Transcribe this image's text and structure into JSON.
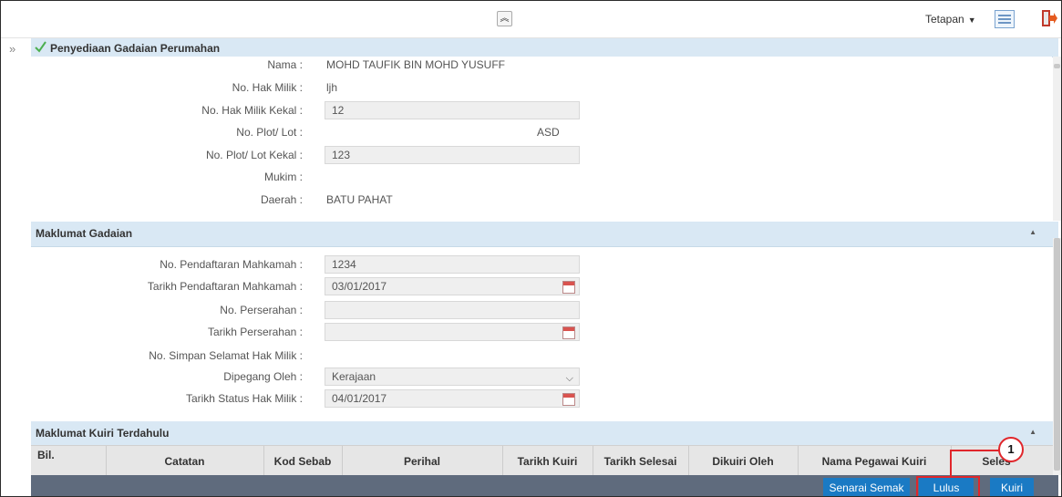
{
  "toolbar": {
    "collapse_glyph": "≈",
    "settings_label": "Tetapan",
    "settings_caret": "▼"
  },
  "side": {
    "expand_glyph": "»"
  },
  "section_prep": {
    "title": "Penyediaan Gadaian Perumahan"
  },
  "property": {
    "nama_label": "Nama :",
    "nama_value": "MOHD TAUFIK BIN MOHD YUSUFF",
    "hakmilik_label": "No. Hak Milik :",
    "hakmilik_value": "ljh",
    "hakmilik_kekal_label": "No. Hak Milik Kekal :",
    "hakmilik_kekal_value": "12",
    "plot_label": "No. Plot/ Lot :",
    "plot_value": "ASD",
    "plot_kekal_label": "No. Plot/ Lot Kekal :",
    "plot_kekal_value": "123",
    "mukim_label": "Mukim :",
    "mukim_value": "",
    "daerah_label": "Daerah :",
    "daerah_value": "BATU PAHAT"
  },
  "section_gadaian": {
    "title": "Maklumat Gadaian",
    "toggle": "▲"
  },
  "gadaian": {
    "pendaftaran_label": "No. Pendaftaran Mahkamah :",
    "pendaftaran_value": "1234",
    "tarikh_pendaftaran_label": "Tarikh Pendaftaran Mahkamah :",
    "tarikh_pendaftaran_value": "03/01/2017",
    "perserahan_label": "No. Perserahan :",
    "perserahan_value": "",
    "tarikh_perserahan_label": "Tarikh Perserahan :",
    "tarikh_perserahan_value": "",
    "simpan_label": "No. Simpan Selamat Hak Milik :",
    "dipegang_label": "Dipegang Oleh :",
    "dipegang_value": "Kerajaan",
    "tarikh_status_label": "Tarikh Status Hak Milik :",
    "tarikh_status_value": "04/01/2017"
  },
  "section_kuiri": {
    "title": "Maklumat Kuiri Terdahulu",
    "toggle": "▲"
  },
  "kuiri_table": {
    "columns": [
      "Bil.",
      "Catatan",
      "Kod Sebab",
      "Perihal",
      "Tarikh Kuiri",
      "Tarikh Selesai",
      "Dikuiri Oleh",
      "Nama Pegawai Kuiri",
      "Seles"
    ]
  },
  "footer": {
    "senarai_semak": "Senarai Semak",
    "lulus": "Lulus",
    "kuiri": "Kuiri"
  },
  "annotation": {
    "step": "1"
  },
  "colors": {
    "section_header": "#d9e8f4",
    "footer_bar": "#5f6b7d",
    "button_blue": "#1a7ac4",
    "annotation_red": "#e0262b"
  },
  "icons": [
    "collapse-up-icon",
    "grid-view-icon",
    "exit-icon",
    "check-icon",
    "calendar-icon",
    "dropdown-arrow-icon"
  ]
}
